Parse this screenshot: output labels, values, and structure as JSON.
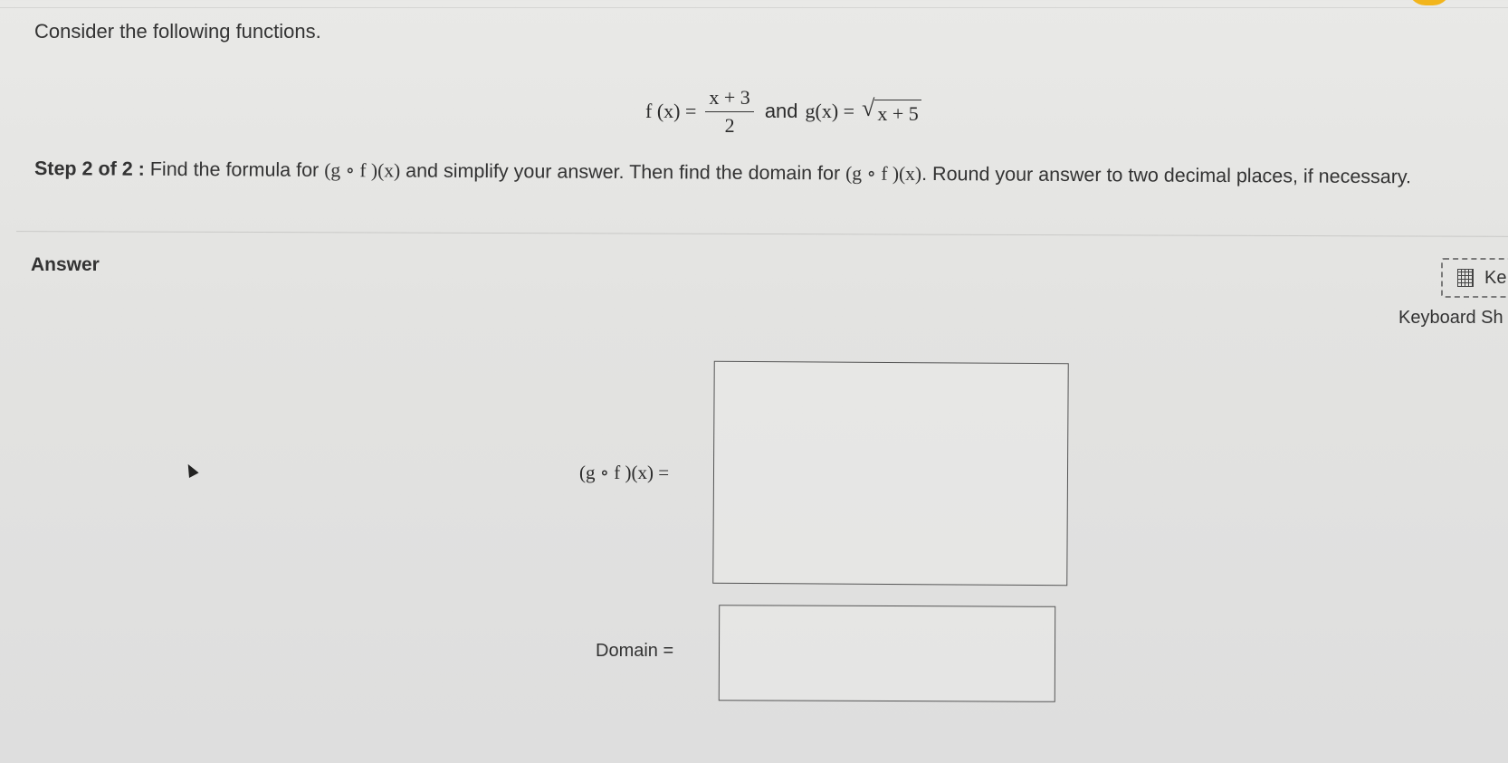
{
  "question": {
    "prompt": "Consider the following functions.",
    "f_lhs": "f (x)  =",
    "f_numerator": "x + 3",
    "f_denominator": "2",
    "and_text": "and",
    "g_lhs": "g(x)  =",
    "g_radicand": "x + 5",
    "step_label": "Step 2 of 2 :",
    "step_text_1": " Find the formula for ",
    "gf_expr": "(g ∘ f )(x)",
    "step_text_2": " and simplify your answer. Then find the domain for ",
    "step_text_3": ". Round your answer to two decimal places, if necessary."
  },
  "answer": {
    "heading": "Answer",
    "keyboard_button_text": "Ke",
    "keyboard_icon": "calculator-icon",
    "keyboard_shortcuts_link": "Keyboard Sh",
    "gf_label": "(g ∘ f )(x)  =",
    "gf_value": "",
    "domain_label": "Domain  =",
    "domain_value": ""
  },
  "colors": {
    "background": "#e5e5e3",
    "text": "#333333",
    "accent": "#f2b51c"
  }
}
